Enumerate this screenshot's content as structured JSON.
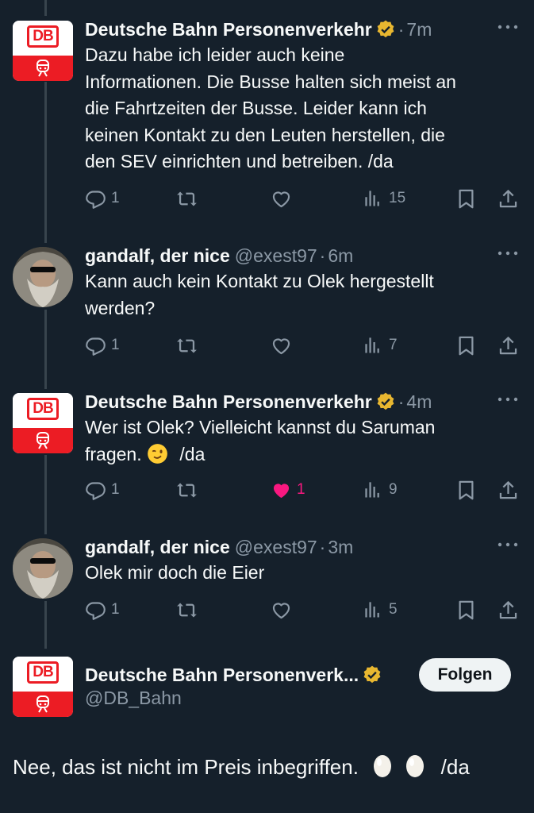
{
  "colors": {
    "background": "#15202b",
    "text": "#f7f9f9",
    "muted": "#8b98a5",
    "like": "#f91880",
    "db_red": "#ec1c24",
    "verified": "#e8b730"
  },
  "replies": [
    {
      "name": "Deutsche Bahn Personenverkehr",
      "handle": "",
      "time": "7m",
      "verified": true,
      "lines": [
        "Dazu habe ich leider auch keine",
        "Informationen. Die Busse halten sich meist an",
        "die Fahrtzeiten der Busse. Leider kann ich",
        "keinen Kontakt zu den Leuten herstellen, die",
        "den SEV einrichten und betreiben. /da"
      ],
      "replies": "1",
      "views": "15",
      "likes": ""
    },
    {
      "name": "gandalf, der nice",
      "handle": "@exest97",
      "time": "6m",
      "verified": false,
      "lines": [
        "Kann auch kein Kontakt zu Olek hergestellt",
        "werden?"
      ],
      "replies": "1",
      "views": "7",
      "likes": ""
    },
    {
      "name": "Deutsche Bahn Personenverkehr",
      "handle": "",
      "time": "4m",
      "verified": true,
      "line1": "Wer ist Olek? Vielleicht kannst du Saruman",
      "line2a": "fragen.",
      "line2b": "/da",
      "replies": "1",
      "views": "9",
      "likes": "1"
    },
    {
      "name": "gandalf, der nice",
      "handle": "@exest97",
      "time": "3m",
      "verified": false,
      "lines": [
        "Olek mir doch die Eier"
      ],
      "replies": "1",
      "views": "5",
      "likes": ""
    }
  ],
  "main_tweet": {
    "name": "Deutsche Bahn Personenverk...",
    "handle": "@DB_Bahn",
    "follow_label": "Folgen",
    "text_a": "Nee, das ist nicht im Preis inbegriffen.",
    "text_b": "/da"
  },
  "logo_text": "DB",
  "icons": [
    "reply-icon",
    "retweet-icon",
    "like-icon",
    "views-icon",
    "bookmark-icon",
    "share-icon",
    "more-icon",
    "verified-badge-icon"
  ]
}
